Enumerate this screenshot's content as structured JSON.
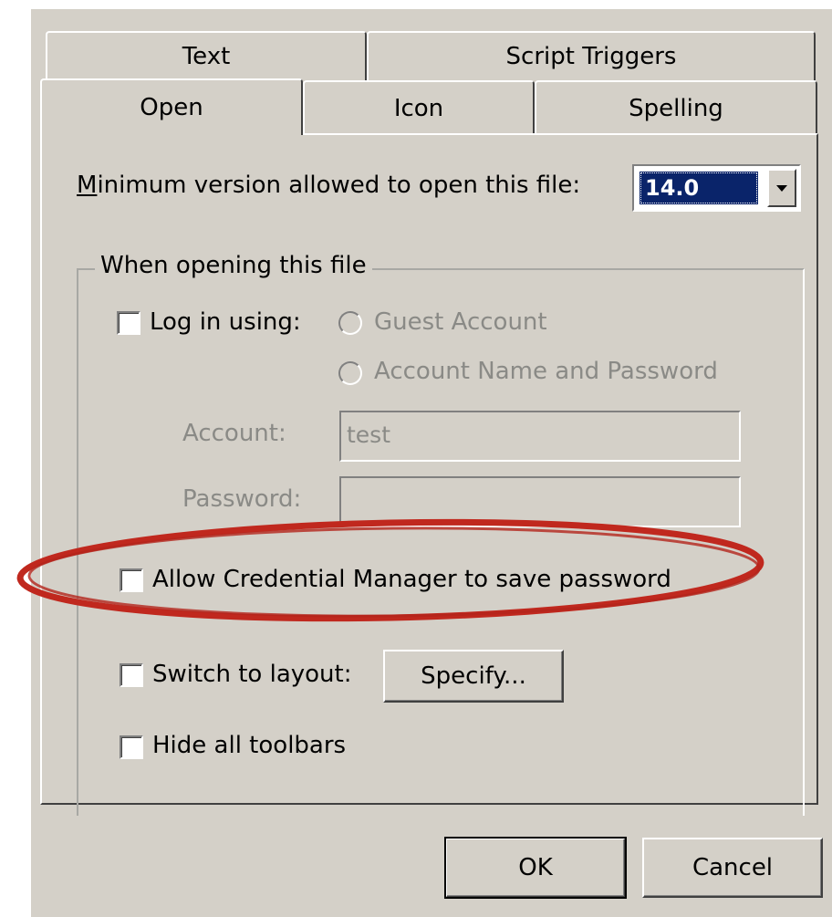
{
  "tabs": {
    "top_row": [
      "Text",
      "Script Triggers"
    ],
    "bottom_row": [
      "Open",
      "Icon",
      "Spelling"
    ],
    "active": "Open"
  },
  "min_version": {
    "label": "Minimum version allowed to open this file:",
    "value": "14.0"
  },
  "group": {
    "title": "When opening this file",
    "login_label": "Log in using:",
    "login_checked": false,
    "guest_account": "Guest Account",
    "account_name_password": "Account Name and Password",
    "account_label": "Account:",
    "account_value": "test",
    "password_label": "Password:",
    "password_value": "",
    "credential_label": "Allow Credential Manager to save password",
    "credential_checked": false,
    "switch_layout_label": "Switch to layout:",
    "switch_layout_checked": false,
    "specify_button": "Specify...",
    "hide_toolbars_label": "Hide all toolbars",
    "hide_toolbars_checked": false
  },
  "buttons": {
    "ok": "OK",
    "cancel": "Cancel"
  },
  "colors": {
    "dialog_bg": "#d4d0c8",
    "selection": "#0a246a",
    "annotation": "#c0281e"
  },
  "icons": {
    "dropdown": "chevron-down-icon"
  }
}
